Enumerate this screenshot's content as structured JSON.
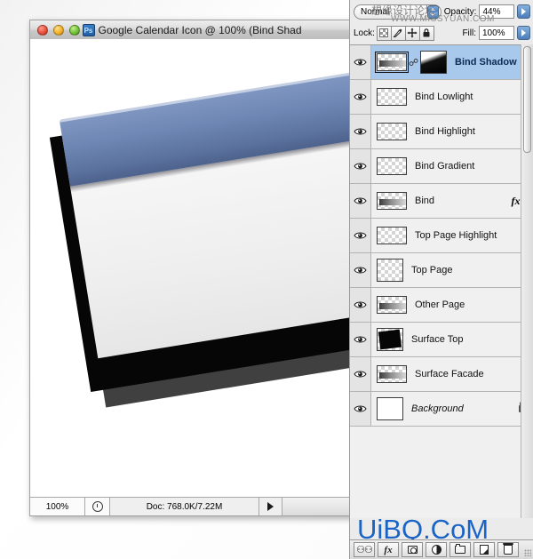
{
  "document_window": {
    "title": "Google Calendar Icon @ 100% (Bind Shad",
    "app_icon": "Ps",
    "traffic_lights": {
      "close_label": "close",
      "minimize_label": "minimize",
      "zoom_label": "zoom"
    },
    "status_bar": {
      "zoom_level": "100%",
      "clock_icon": "clock-icon",
      "doc_info": "Doc: 768.0K/7.22M",
      "menu_arrow": "triangle-right-icon"
    }
  },
  "layers_panel": {
    "blend_mode": {
      "label": "Normal",
      "stepper_icon": "updown-stepper-icon"
    },
    "opacity": {
      "label": "Opacity:",
      "value": "44%",
      "arrow_icon": "triangle-right-icon"
    },
    "fill": {
      "label": "Fill:",
      "value": "100%",
      "arrow_icon": "triangle-right-icon"
    },
    "lock": {
      "label": "Lock:",
      "buttons": [
        {
          "name": "lock-transparency",
          "icon": "checkerboard-icon"
        },
        {
          "name": "lock-image",
          "icon": "brush-icon"
        },
        {
          "name": "lock-position",
          "icon": "move-icon"
        },
        {
          "name": "lock-all",
          "icon": "padlock-icon"
        }
      ]
    },
    "layers": [
      {
        "name": "Bind Shadow",
        "selected": true,
        "visible": true,
        "has_mask": true,
        "linked": true,
        "has_fx": false,
        "locked": false,
        "italic": false,
        "thumb_style": "streak"
      },
      {
        "name": "Bind Lowlight",
        "selected": false,
        "visible": true,
        "has_mask": false,
        "linked": false,
        "has_fx": false,
        "locked": false,
        "italic": false,
        "thumb_style": "faint"
      },
      {
        "name": "Bind Highlight",
        "selected": false,
        "visible": true,
        "has_mask": false,
        "linked": false,
        "has_fx": false,
        "locked": false,
        "italic": false,
        "thumb_style": "faint"
      },
      {
        "name": "Bind Gradient",
        "selected": false,
        "visible": true,
        "has_mask": false,
        "linked": false,
        "has_fx": false,
        "locked": false,
        "italic": false,
        "thumb_style": "faint"
      },
      {
        "name": "Bind",
        "selected": false,
        "visible": true,
        "has_mask": false,
        "linked": false,
        "has_fx": true,
        "fx_label": "fx",
        "locked": false,
        "italic": false,
        "thumb_style": "streak"
      },
      {
        "name": "Top Page Highlight",
        "selected": false,
        "visible": true,
        "has_mask": false,
        "linked": false,
        "has_fx": false,
        "locked": false,
        "italic": false,
        "thumb_style": "faint"
      },
      {
        "name": "Top Page",
        "selected": false,
        "visible": true,
        "has_mask": false,
        "linked": false,
        "has_fx": false,
        "locked": false,
        "italic": false,
        "thumb_style": "square-light"
      },
      {
        "name": "Other Page",
        "selected": false,
        "visible": true,
        "has_mask": false,
        "linked": false,
        "has_fx": false,
        "locked": false,
        "italic": false,
        "thumb_style": "streak"
      },
      {
        "name": "Surface Top",
        "selected": false,
        "visible": true,
        "has_mask": false,
        "linked": false,
        "has_fx": false,
        "locked": false,
        "italic": false,
        "thumb_style": "square-black"
      },
      {
        "name": "Surface Facade",
        "selected": false,
        "visible": true,
        "has_mask": false,
        "linked": false,
        "has_fx": false,
        "locked": false,
        "italic": false,
        "thumb_style": "streak"
      },
      {
        "name": "Background",
        "selected": false,
        "visible": true,
        "has_mask": false,
        "linked": false,
        "has_fx": false,
        "locked": true,
        "italic": true,
        "thumb_style": "square-white"
      }
    ],
    "bottom_bar": [
      {
        "name": "link-layers-button",
        "icon": "link-icon"
      },
      {
        "name": "layer-style-button",
        "icon": "fx-icon",
        "label": "fx"
      },
      {
        "name": "add-layer-mask-button",
        "icon": "mask-icon"
      },
      {
        "name": "new-adjustment-layer-button",
        "icon": "adjustment-icon"
      },
      {
        "name": "new-group-button",
        "icon": "folder-icon"
      },
      {
        "name": "new-layer-button",
        "icon": "new-layer-icon"
      },
      {
        "name": "delete-layer-button",
        "icon": "trash-icon"
      }
    ]
  },
  "watermarks": {
    "site": "UiBQ.CoM",
    "forum_cn": "想缘设计论坛",
    "forum_url": "WWW.MISSYUAN.COM"
  },
  "colors": {
    "selection_blue": "#a8c8ec",
    "bind_blue": "#6f87b4",
    "watermark_blue": "#1b63c4",
    "panel_gray": "#ebebeb"
  }
}
